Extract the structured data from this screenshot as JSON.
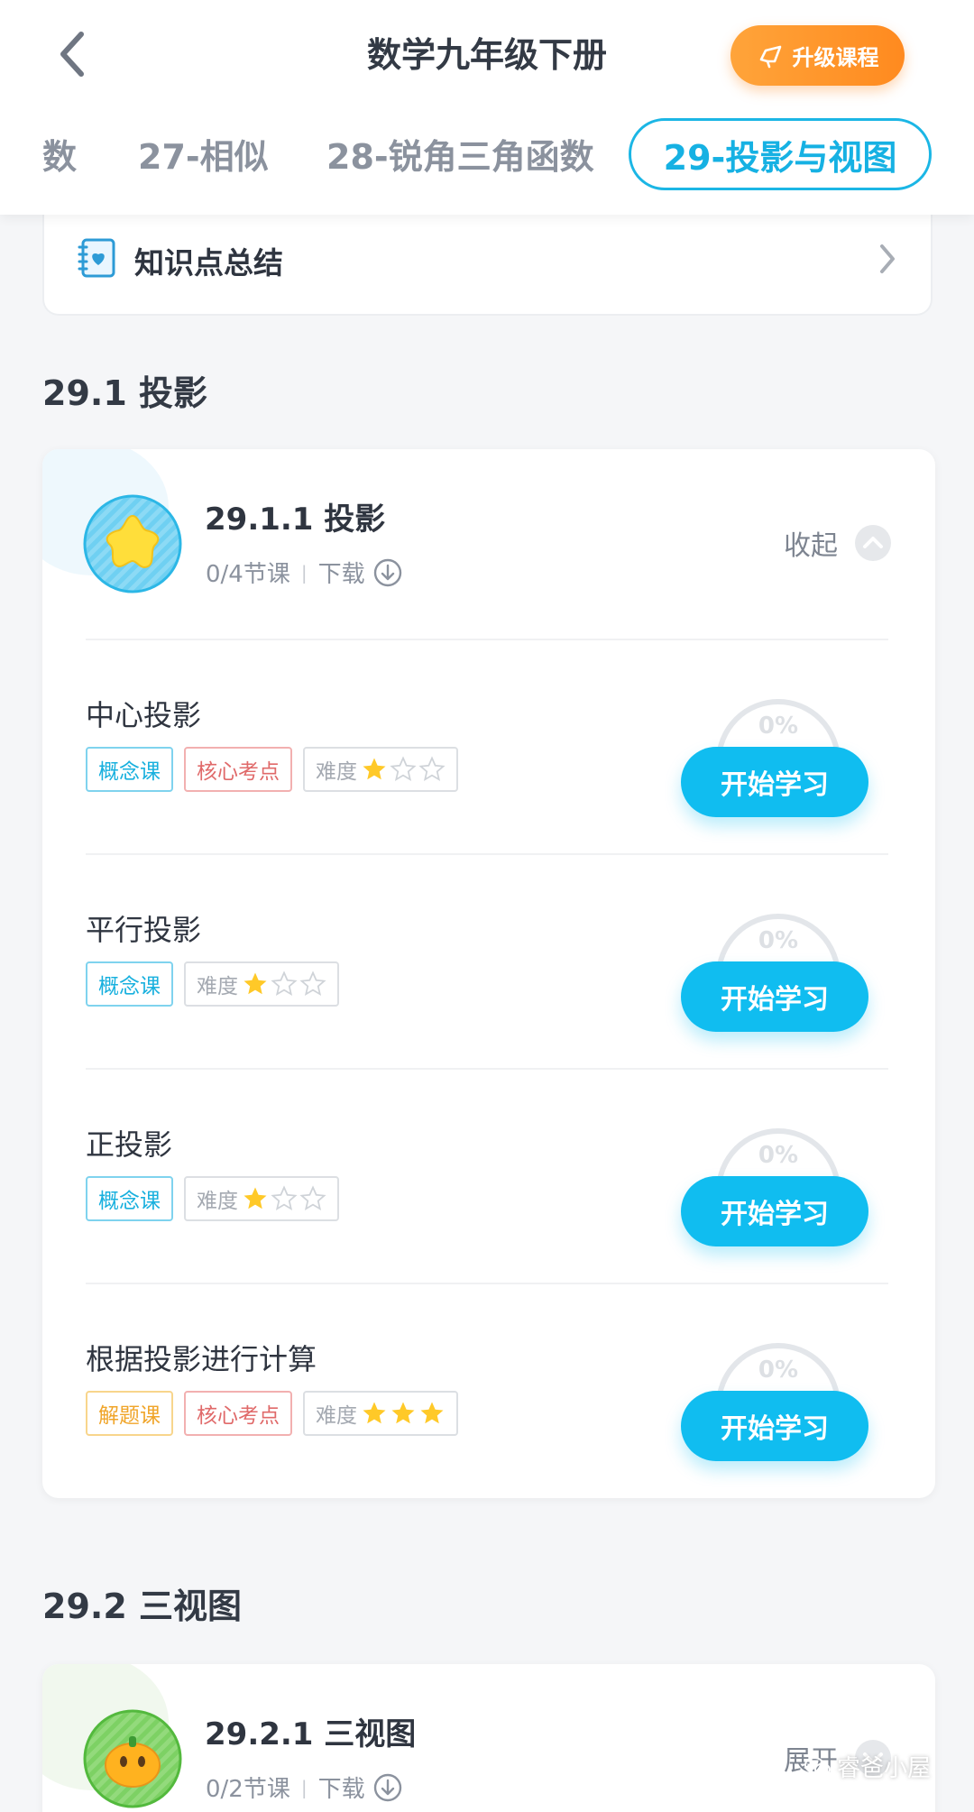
{
  "header": {
    "title": "数学九年级下册",
    "upgrade_label": "升级课程",
    "tabs": [
      "数",
      "27-相似",
      "28-锐角三角函数",
      "29-投影与视图"
    ]
  },
  "summary": {
    "label": "知识点总结"
  },
  "sections": [
    {
      "title": "29.1 投影",
      "unit": {
        "title": "29.1.1 投影",
        "progress": "0/4节课",
        "download": "下载",
        "toggle": "收起",
        "lessons": [
          {
            "name": "中心投影",
            "tags": [
              "概念课",
              "核心考点"
            ],
            "difficulty_label": "难度",
            "difficulty": 1,
            "percent": "0%",
            "button": "开始学习"
          },
          {
            "name": "平行投影",
            "tags": [
              "概念课"
            ],
            "difficulty_label": "难度",
            "difficulty": 1,
            "percent": "0%",
            "button": "开始学习"
          },
          {
            "name": "正投影",
            "tags": [
              "概念课"
            ],
            "difficulty_label": "难度",
            "difficulty": 1,
            "percent": "0%",
            "button": "开始学习"
          },
          {
            "name": "根据投影进行计算",
            "tags": [
              "解题课",
              "核心考点"
            ],
            "difficulty_label": "难度",
            "difficulty": 3,
            "percent": "0%",
            "button": "开始学习"
          }
        ]
      }
    },
    {
      "title": "29.2 三视图",
      "unit": {
        "title": "29.2.1 三视图",
        "progress": "0/2节课",
        "download": "下载",
        "toggle": "展开"
      }
    }
  ],
  "watermark": "睿爸小屋",
  "colors": {
    "accent": "#10bdf0",
    "upgrade": "#ff9a2e",
    "star": "#ffc928"
  }
}
